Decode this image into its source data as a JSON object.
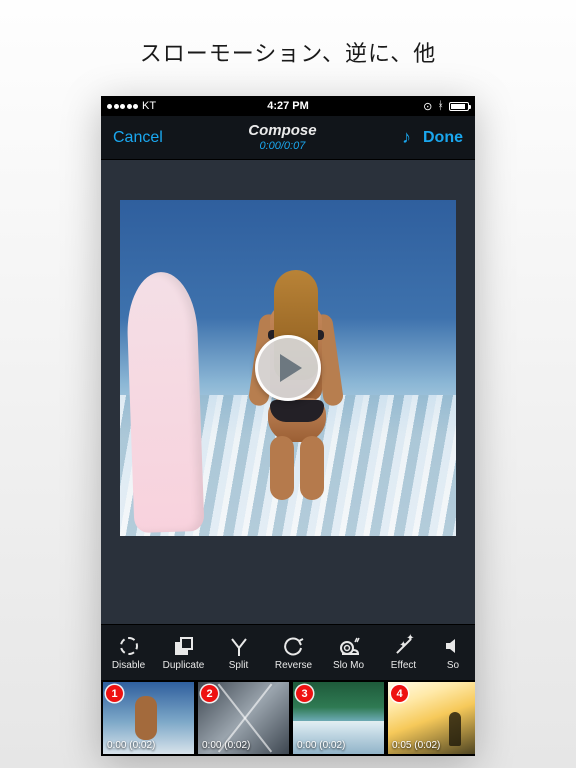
{
  "promo": {
    "title": "スローモーション、逆に、他"
  },
  "statusbar": {
    "carrier": "KT",
    "time": "4:27 PM"
  },
  "nav": {
    "cancel": "Cancel",
    "title": "Compose",
    "timecode": "0:00/0:07",
    "done": "Done"
  },
  "toolbar": {
    "items": [
      {
        "id": "disable",
        "label": "Disable"
      },
      {
        "id": "duplicate",
        "label": "Duplicate"
      },
      {
        "id": "split",
        "label": "Split"
      },
      {
        "id": "reverse",
        "label": "Reverse"
      },
      {
        "id": "slomo",
        "label": "Slo Mo"
      },
      {
        "id": "effect",
        "label": "Effect"
      },
      {
        "id": "sound",
        "label": "So"
      }
    ]
  },
  "clips": [
    {
      "badge": "1",
      "time": "0:00 (0:02)"
    },
    {
      "badge": "2",
      "time": "0:00 (0:02)"
    },
    {
      "badge": "3",
      "time": "0:00 (0:02)"
    },
    {
      "badge": "4",
      "time": "0:05 (0:02)"
    }
  ]
}
